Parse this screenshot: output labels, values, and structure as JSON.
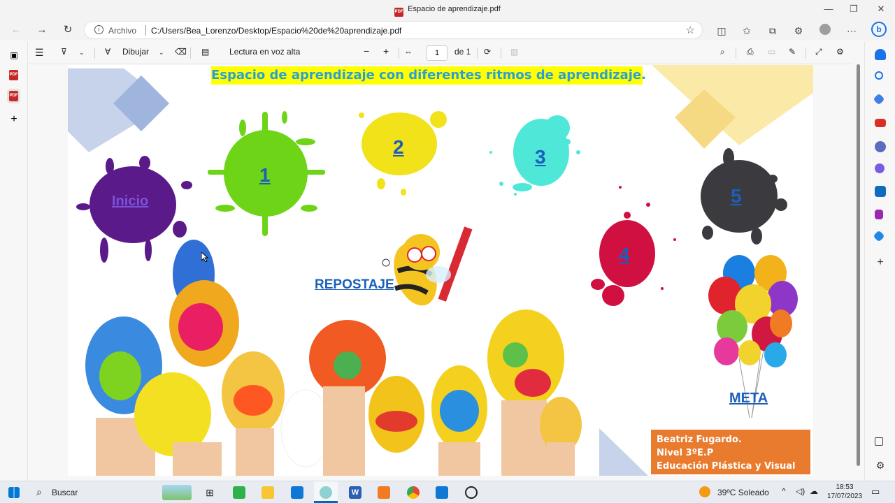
{
  "window": {
    "title": "Espacio de aprendizaje.pdf",
    "minimize": "—",
    "restore": "❐",
    "close": "✕"
  },
  "address": {
    "protocol_label": "Archivo",
    "url": "C:/Users/Bea_Lorenzo/Desktop/Espacio%20de%20aprendizaje.pdf"
  },
  "pdf_toolbar": {
    "draw_label": "Dibujar",
    "read_aloud_label": "Lectura en voz alta",
    "page_value": "1",
    "page_total": "de 1"
  },
  "document": {
    "heading": "Espacio de aprendizaje con diferentes ritmos de aprendizaje.",
    "links": {
      "inicio": "Inicio",
      "step1": "1",
      "step2": "2",
      "step3": "3",
      "step4": "4",
      "step5": "5",
      "repostaje": "REPOSTAJE",
      "meta": "META"
    },
    "author": {
      "line1": "Beatriz Fugardo.",
      "line2": "Nivel 3ºE.P",
      "line3": "Educación Plástica y Visual"
    }
  },
  "taskbar": {
    "search_label": "Buscar",
    "weather": "39ºC Soleado",
    "time": "18:53",
    "date": "17/07/2023"
  },
  "colors": {
    "heading_bg": "#ffff00",
    "heading_text": "#2a9fd6",
    "link": "#1c5fb8",
    "author_bg": "#e97b2e"
  }
}
